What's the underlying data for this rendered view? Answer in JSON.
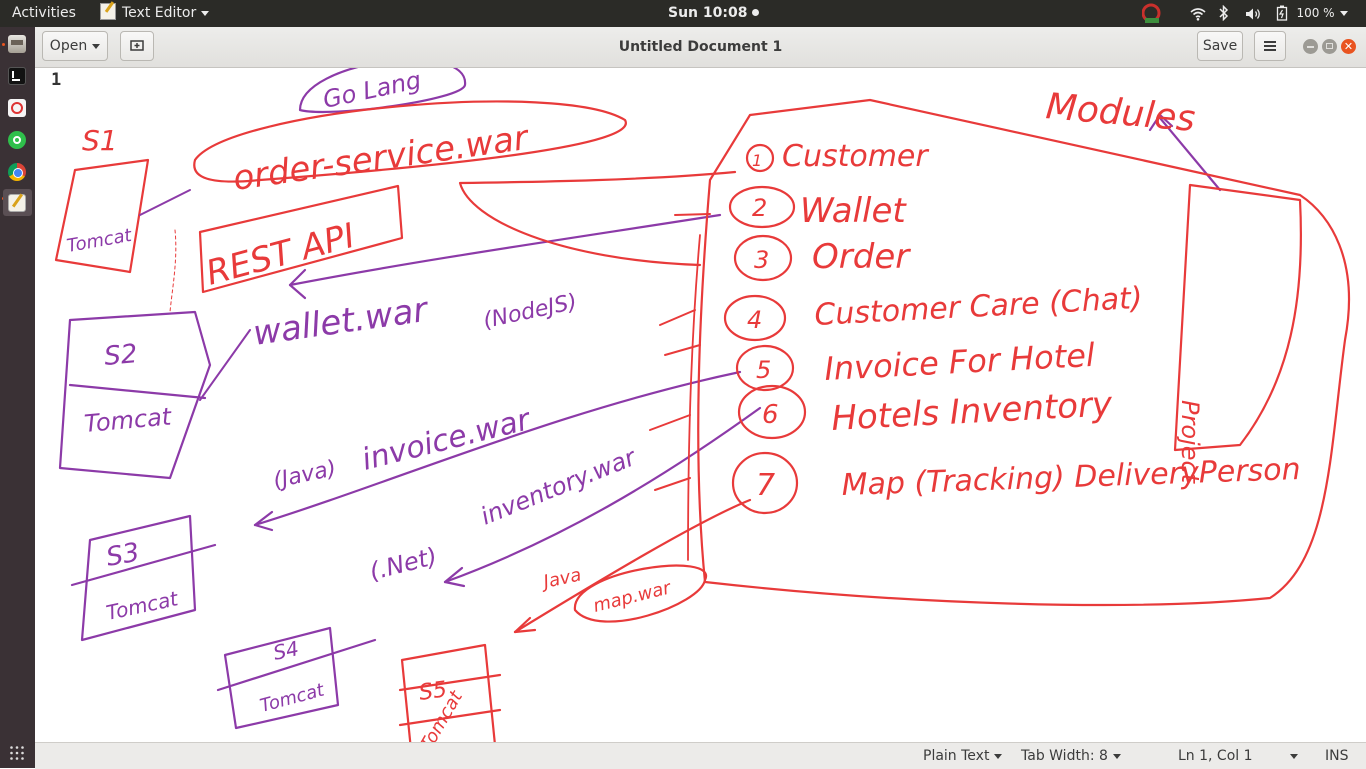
{
  "topbar": {
    "activities": "Activities",
    "app_name": "Text Editor",
    "clock": "Sun 10:08",
    "battery": "100 %"
  },
  "headerbar": {
    "open_label": "Open",
    "title": "Untitled Document 1",
    "save_label": "Save"
  },
  "editor": {
    "line_number": "1"
  },
  "statusbar": {
    "language": "Plain Text",
    "tab_width": "Tab Width: 8",
    "position": "Ln 1, Col 1",
    "mode": "INS"
  },
  "annotations": {
    "s1": "S1",
    "tomcat": "Tomcat",
    "go_lang": "Go Lang",
    "order_service_war": "order-service.war",
    "rest_api": "REST API",
    "s2": "S2",
    "wallet_war": "wallet.war",
    "node_js": "(NodeJS)",
    "java": "(Java)",
    "invoice_war": "invoice.war",
    "s3": "S3",
    "dot_net": "(.Net)",
    "inventory_war": "inventory.war",
    "java2": "Java",
    "map_war": "map.war",
    "s4": "S4",
    "s5": "S5",
    "modules": "Modules",
    "project": "Project",
    "modules_list": [
      {
        "num": "1",
        "name": "Customer"
      },
      {
        "num": "2",
        "name": "Wallet"
      },
      {
        "num": "3",
        "name": "Order"
      },
      {
        "num": "4",
        "name": "Customer Care (Chat)"
      },
      {
        "num": "5",
        "name": "Invoice For Hotel"
      },
      {
        "num": "6",
        "name": "Hotels Inventory"
      },
      {
        "num": "7",
        "name": "Map (Tracking) DeliveryPerson"
      }
    ]
  },
  "colors": {
    "red_ink": "#e83a3a",
    "purple_ink": "#8c3aa8",
    "topbar_bg": "#2b2b27",
    "dock_bg": "#3a3135",
    "accent": "#e95420"
  }
}
